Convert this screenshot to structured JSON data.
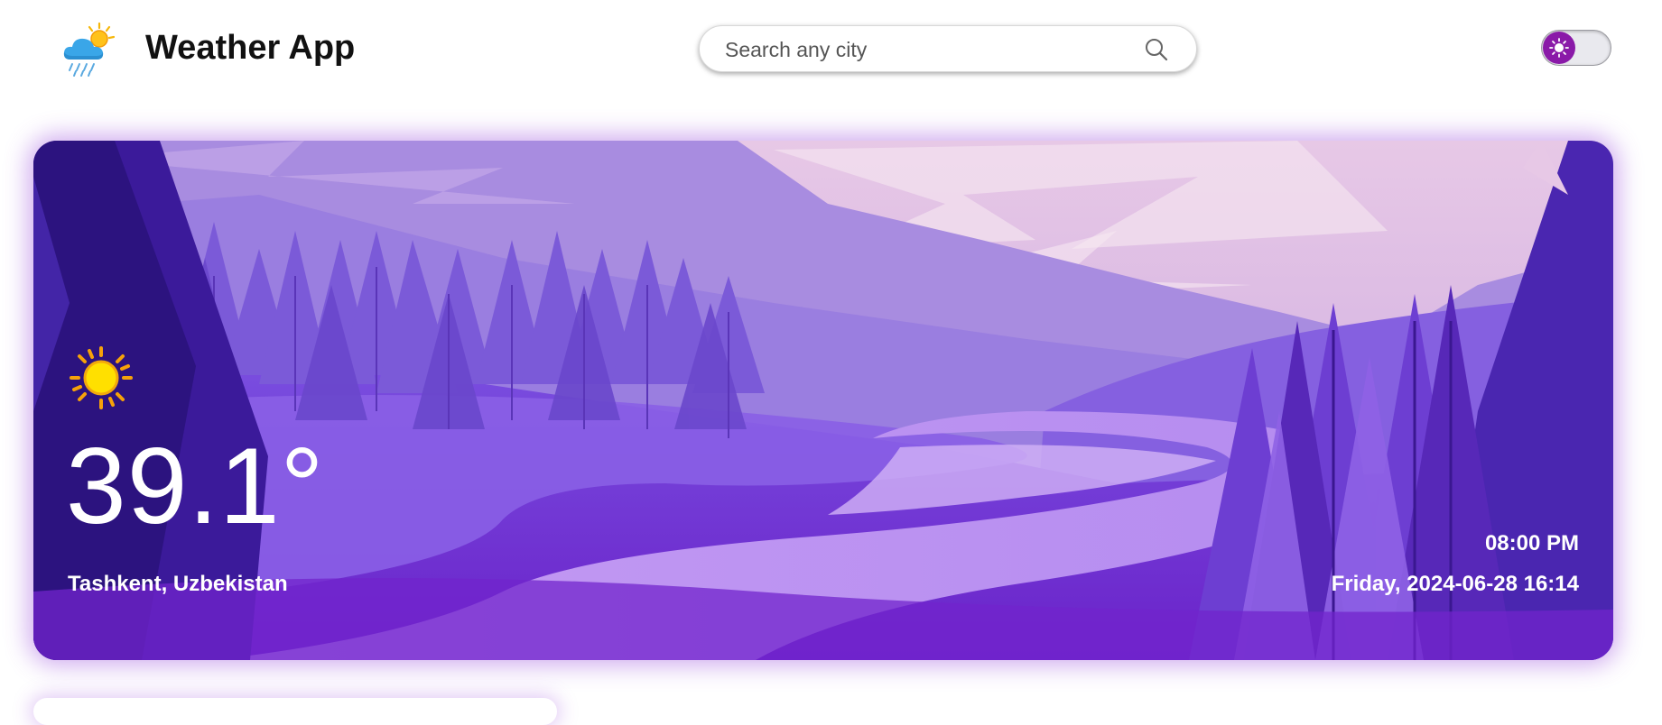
{
  "header": {
    "app_title": "Weather App",
    "logo_icon": "cloud-sun-rain-icon",
    "search": {
      "placeholder": "Search any city",
      "value": "",
      "icon": "search-icon"
    },
    "theme_toggle": {
      "state": "light",
      "icon": "sun-icon",
      "knob_color": "#8a1aa8"
    }
  },
  "current": {
    "condition_icon": "sun-icon",
    "temperature": "39.1°",
    "location": "Tashkent, Uzbekistan",
    "time": "08:00 PM",
    "datetime": "Friday, 2024-06-28 16:14"
  },
  "colors": {
    "accent": "#8a1aa8",
    "hero_glow": "#9646dc"
  }
}
